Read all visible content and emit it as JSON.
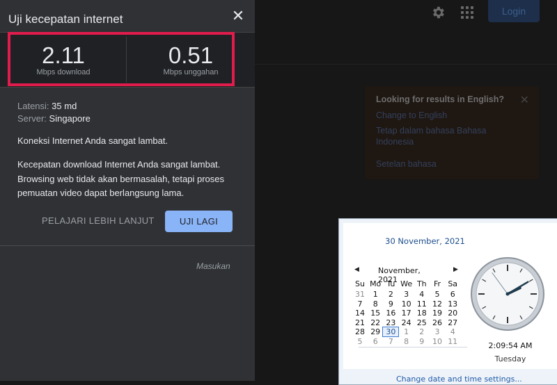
{
  "google_bg": {
    "login_label": "Login",
    "language_card": {
      "title": "Looking for results in English?",
      "change_link": "Change to English",
      "stay_link": "Tetap dalam bahasa Bahasa Indonesia",
      "settings_link": "Setelan bahasa"
    }
  },
  "speed_test": {
    "title": "Uji kecepatan internet",
    "download": {
      "value": "2.11",
      "unit": "Mbps download"
    },
    "upload": {
      "value": "0.51",
      "unit": "Mbps unggahan"
    },
    "latency_label": "Latensi:",
    "latency_value": "35 md",
    "server_label": "Server:",
    "server_value": "Singapore",
    "summary": "Koneksi Internet Anda sangat lambat.",
    "detail": "Kecepatan download Internet Anda sangat lambat. Browsing web tidak akan bermasalah, tetapi proses pemuatan video dapat berlangsung lama.",
    "learn_more_label": "PELAJARI LEBIH LANJUT",
    "retry_label": "UJI LAGI",
    "feedback_label": "Masukan",
    "highlight_color": "#e01c4d"
  },
  "clock_popup": {
    "date_long": "30 November, 2021",
    "month_label": "November, 2021",
    "weekdays": [
      "Su",
      "Mo",
      "Tu",
      "We",
      "Th",
      "Fr",
      "Sa"
    ],
    "weeks": [
      [
        {
          "d": "31",
          "dim": true
        },
        {
          "d": "1"
        },
        {
          "d": "2"
        },
        {
          "d": "3"
        },
        {
          "d": "4"
        },
        {
          "d": "5"
        },
        {
          "d": "6"
        }
      ],
      [
        {
          "d": "7"
        },
        {
          "d": "8"
        },
        {
          "d": "9"
        },
        {
          "d": "10"
        },
        {
          "d": "11"
        },
        {
          "d": "12"
        },
        {
          "d": "13"
        }
      ],
      [
        {
          "d": "14"
        },
        {
          "d": "15"
        },
        {
          "d": "16"
        },
        {
          "d": "17"
        },
        {
          "d": "18"
        },
        {
          "d": "19"
        },
        {
          "d": "20"
        }
      ],
      [
        {
          "d": "21"
        },
        {
          "d": "22"
        },
        {
          "d": "23"
        },
        {
          "d": "24"
        },
        {
          "d": "25"
        },
        {
          "d": "26"
        },
        {
          "d": "27"
        }
      ],
      [
        {
          "d": "28"
        },
        {
          "d": "29"
        },
        {
          "d": "30",
          "today": true
        },
        {
          "d": "1",
          "dim": true
        },
        {
          "d": "2",
          "dim": true
        },
        {
          "d": "3",
          "dim": true
        },
        {
          "d": "4",
          "dim": true
        }
      ],
      [
        {
          "d": "5",
          "dim": true
        },
        {
          "d": "6",
          "dim": true
        },
        {
          "d": "7",
          "dim": true
        },
        {
          "d": "8",
          "dim": true
        },
        {
          "d": "9",
          "dim": true
        },
        {
          "d": "10",
          "dim": true
        },
        {
          "d": "11",
          "dim": true
        }
      ]
    ],
    "time": "2:09:54 AM",
    "day": "Tuesday",
    "change_link": "Change date and time settings..."
  }
}
